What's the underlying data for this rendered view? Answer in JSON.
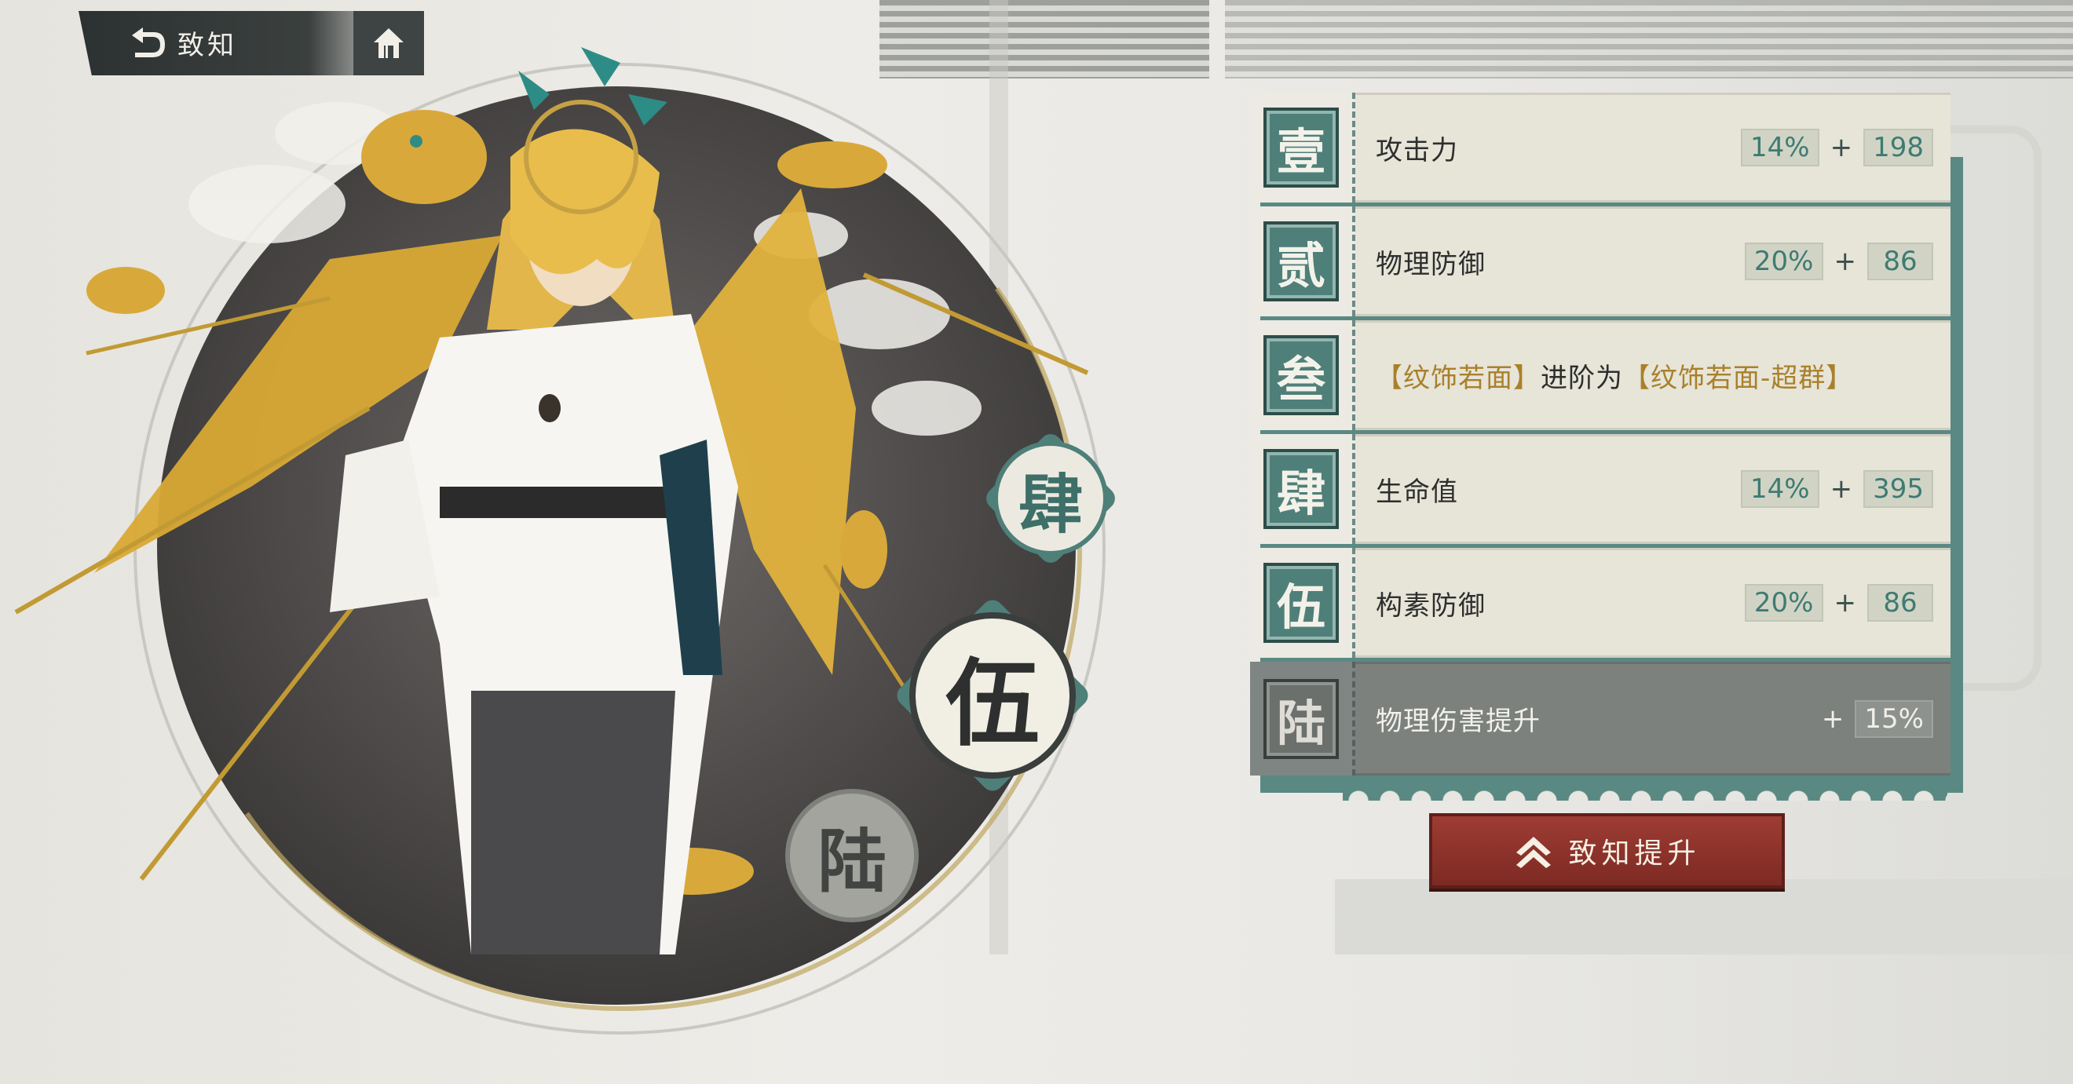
{
  "topbar": {
    "back_label": "致知",
    "icons": {
      "back": "back-arrow-icon",
      "home": "home-icon"
    }
  },
  "nodes": {
    "four": "肆",
    "five": "伍",
    "six": "陆"
  },
  "stats": [
    {
      "index": "壹",
      "label": "攻击力",
      "percent": "14%",
      "plus": "+",
      "flat": "198"
    },
    {
      "index": "贰",
      "label": "物理防御",
      "percent": "20%",
      "plus": "+",
      "flat": "86"
    },
    {
      "index": "叁",
      "bracket_open_1": "【",
      "name1": "纹饰若面",
      "bracket_close_1": "】",
      "middle": "进阶为",
      "bracket_open_2": "【",
      "name2": "纹饰若面-超群",
      "bracket_close_2": "】"
    },
    {
      "index": "肆",
      "label": "生命值",
      "percent": "14%",
      "plus": "+",
      "flat": "395"
    },
    {
      "index": "伍",
      "label": "构素防御",
      "percent": "20%",
      "plus": "+",
      "flat": "86"
    },
    {
      "index": "陆",
      "label": "物理伤害提升",
      "plus": "+",
      "percent": "15%",
      "locked": true
    }
  ],
  "upgrade_button": {
    "label": "致知提升",
    "icon": "double-chevron-up-icon"
  },
  "colors": {
    "teal": "#4f7f79",
    "gold": "#a9802a",
    "red": "#8d332b",
    "dark": "#3b403f"
  }
}
